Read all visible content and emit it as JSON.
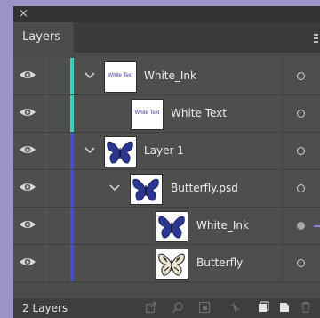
{
  "panel": {
    "close_glyph": "×",
    "tab_label": "Layers",
    "footer_count": "2 Layers"
  },
  "layers": [
    {
      "name": "White_Ink",
      "thumb": "text",
      "thumb_text": "White Text",
      "bar_color": "#3fd0c0",
      "expanded": true,
      "target": "hollow"
    },
    {
      "name": "White Text",
      "thumb": "text",
      "thumb_text": "White Text",
      "bar_color": "#3fd0c0",
      "expanded": null,
      "target": "hollow"
    },
    {
      "name": "Layer 1",
      "thumb": "butterfly-blue",
      "bar_color": "#4a4fc0",
      "expanded": true,
      "target": "hollow"
    },
    {
      "name": "Butterfly.psd",
      "thumb": "butterfly-blue",
      "bar_color": "#4a4fc0",
      "expanded": true,
      "target": "hollow"
    },
    {
      "name": "White_Ink",
      "thumb": "butterfly-blue",
      "bar_color": "#4a4fc0",
      "expanded": null,
      "target": "filled"
    },
    {
      "name": "Butterfly",
      "thumb": "butterfly-photo",
      "bar_color": "#4a4fc0",
      "expanded": null,
      "target": "hollow"
    }
  ],
  "colors": {
    "panel_bg": "#4b4b4b",
    "outer_bg": "#9b92c6",
    "accent_teal": "#3fd0c0",
    "accent_blue": "#4a4fc0"
  },
  "footer_icons": [
    "export-icon",
    "search-icon",
    "clipping-mask-icon",
    "link-icon",
    "new-sublayer-icon",
    "new-layer-icon",
    "delete-icon"
  ]
}
